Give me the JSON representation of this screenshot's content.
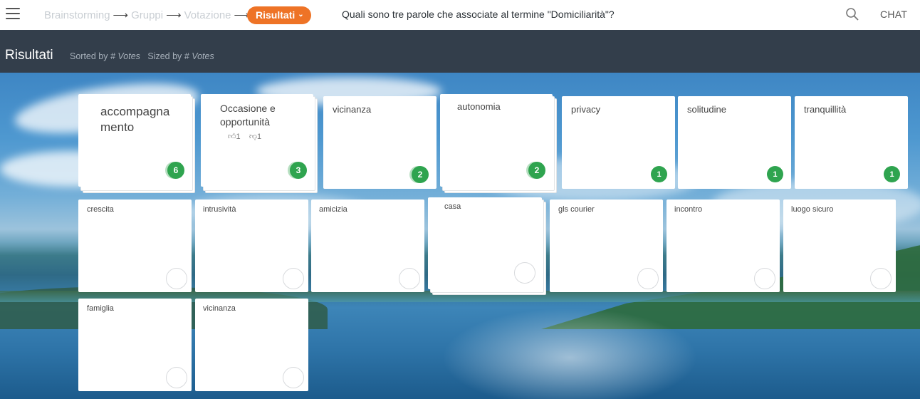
{
  "topbar": {
    "steps": [
      "Brainstorming",
      "Gruppi",
      "Votazione"
    ],
    "active_step": "Risultati",
    "question": "Quali sono tre parole che associate al termine \"Domiciliarità\"?",
    "chat_label": "CHAT",
    "accent_color": "#ee7326"
  },
  "results": {
    "title": "Risultati",
    "sorted_prefix": "Sorted by",
    "sorted_value": "# Votes",
    "sized_prefix": "Sized by",
    "sized_value": "# Votes"
  },
  "cards_row1": [
    {
      "label": "accompagna mento",
      "votes": "6",
      "stacked": true
    },
    {
      "label": "Occasione e opportunità",
      "votes": "3",
      "stacked": true,
      "up": "1",
      "down": "1"
    },
    {
      "label": "vicinanza",
      "votes": "2",
      "stacked": false
    },
    {
      "label": "autonomia",
      "votes": "2",
      "stacked": true
    },
    {
      "label": "privacy",
      "votes": "1",
      "stacked": false
    },
    {
      "label": "solitudine",
      "votes": "1",
      "stacked": false
    },
    {
      "label": "tranquillità",
      "votes": "1",
      "stacked": false
    }
  ],
  "cards_row2": [
    {
      "label": "crescita"
    },
    {
      "label": "intrusività"
    },
    {
      "label": "amicizia"
    },
    {
      "label": "casa",
      "stacked": true
    },
    {
      "label": "gls courier"
    },
    {
      "label": "incontro"
    },
    {
      "label": "luogo sicuro"
    }
  ],
  "cards_row3": [
    {
      "label": "famiglia"
    },
    {
      "label": "vicinanza"
    }
  ],
  "colors": {
    "vote_badge": "#2fa44f",
    "header_bg": "#333e4b"
  }
}
